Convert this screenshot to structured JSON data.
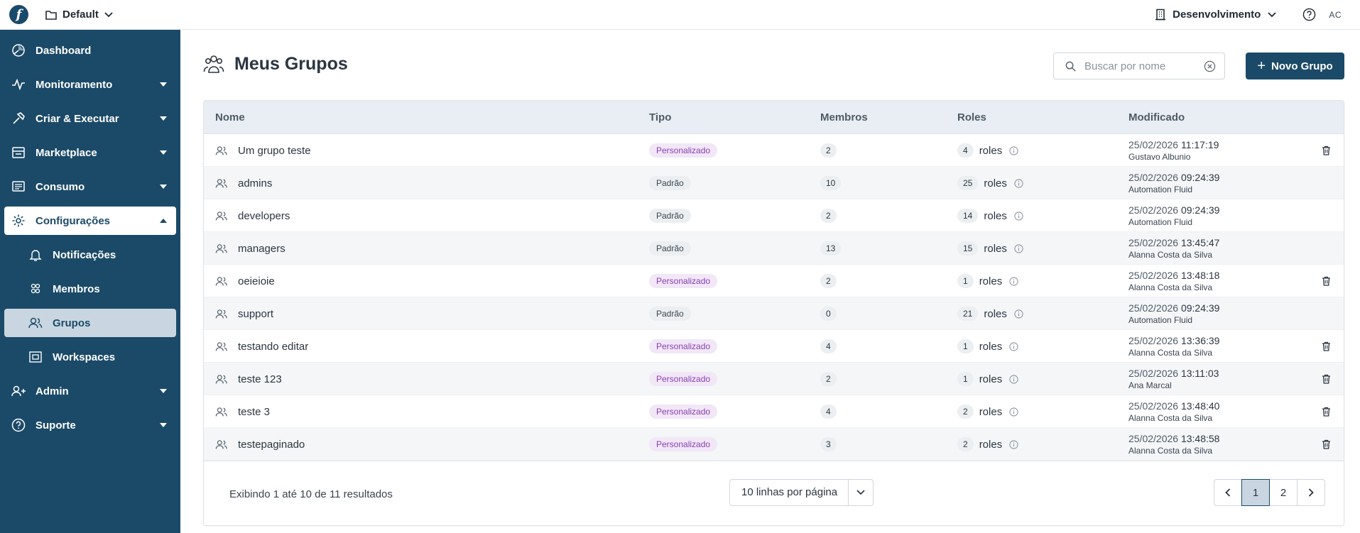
{
  "topbar": {
    "logo_text": "f",
    "workspace_label": "Default",
    "environment_label": "Desenvolvimento",
    "avatar_initials": "AC"
  },
  "sidebar": {
    "items": [
      {
        "label": "Dashboard",
        "icon": "dashboard-icon"
      },
      {
        "label": "Monitoramento",
        "icon": "activity-icon"
      },
      {
        "label": "Criar & Executar",
        "icon": "hammer-icon"
      },
      {
        "label": "Marketplace",
        "icon": "store-icon"
      },
      {
        "label": "Consumo",
        "icon": "receipt-icon"
      },
      {
        "label": "Configurações",
        "icon": "gear-icon"
      },
      {
        "label": "Admin",
        "icon": "user-plus-icon"
      },
      {
        "label": "Suporte",
        "icon": "help-icon"
      }
    ],
    "sub_items": [
      {
        "label": "Notificações",
        "icon": "bell-icon"
      },
      {
        "label": "Membros",
        "icon": "members-icon"
      },
      {
        "label": "Grupos",
        "icon": "groups-icon"
      },
      {
        "label": "Workspaces",
        "icon": "workspace-icon"
      }
    ]
  },
  "page": {
    "title": "Meus Grupos",
    "search_placeholder": "Buscar por nome",
    "new_button_label": "Novo Grupo"
  },
  "table": {
    "headers": {
      "name": "Nome",
      "tipo": "Tipo",
      "membros": "Membros",
      "roles": "Roles",
      "modificado": "Modificado"
    },
    "roles_word": "roles",
    "rows": [
      {
        "name": "Um grupo teste",
        "tipo": "Personalizado",
        "membros": "2",
        "roles": "4",
        "date": "25/02/2026",
        "time": "11:17:19",
        "by": "Gustavo Albunio",
        "deletable": true
      },
      {
        "name": "admins",
        "tipo": "Padrão",
        "membros": "10",
        "roles": "25",
        "date": "25/02/2026",
        "time": "09:24:39",
        "by": "Automation Fluid",
        "deletable": false
      },
      {
        "name": "developers",
        "tipo": "Padrão",
        "membros": "2",
        "roles": "14",
        "date": "25/02/2026",
        "time": "09:24:39",
        "by": "Automation Fluid",
        "deletable": false
      },
      {
        "name": "managers",
        "tipo": "Padrão",
        "membros": "13",
        "roles": "15",
        "date": "25/02/2026",
        "time": "13:45:47",
        "by": "Alanna Costa da Silva",
        "deletable": false
      },
      {
        "name": "oeieioie",
        "tipo": "Personalizado",
        "membros": "2",
        "roles": "1",
        "date": "25/02/2026",
        "time": "13:48:18",
        "by": "Alanna Costa da Silva",
        "deletable": true
      },
      {
        "name": "support",
        "tipo": "Padrão",
        "membros": "0",
        "roles": "21",
        "date": "25/02/2026",
        "time": "09:24:39",
        "by": "Automation Fluid",
        "deletable": false
      },
      {
        "name": "testando editar",
        "tipo": "Personalizado",
        "membros": "4",
        "roles": "1",
        "date": "25/02/2026",
        "time": "13:36:39",
        "by": "Alanna Costa da Silva",
        "deletable": true
      },
      {
        "name": "teste 123",
        "tipo": "Personalizado",
        "membros": "2",
        "roles": "1",
        "date": "25/02/2026",
        "time": "13:11:03",
        "by": "Ana Marcal",
        "deletable": true
      },
      {
        "name": "teste 3",
        "tipo": "Personalizado",
        "membros": "4",
        "roles": "2",
        "date": "25/02/2026",
        "time": "13:48:40",
        "by": "Alanna Costa da Silva",
        "deletable": true
      },
      {
        "name": "testepaginado",
        "tipo": "Personalizado",
        "membros": "3",
        "roles": "2",
        "date": "25/02/2026",
        "time": "13:48:58",
        "by": "Alanna Costa da Silva",
        "deletable": true
      }
    ]
  },
  "footer": {
    "results_text": "Exibindo 1 até 10 de 11 resultados",
    "per_page_label": "10 linhas por página",
    "pages": [
      "1",
      "2"
    ],
    "current_page": "1"
  },
  "colors": {
    "brand": "#1b4a68",
    "custom_badge": "#8a3fb0",
    "selected_bg": "#c9d6e1"
  }
}
